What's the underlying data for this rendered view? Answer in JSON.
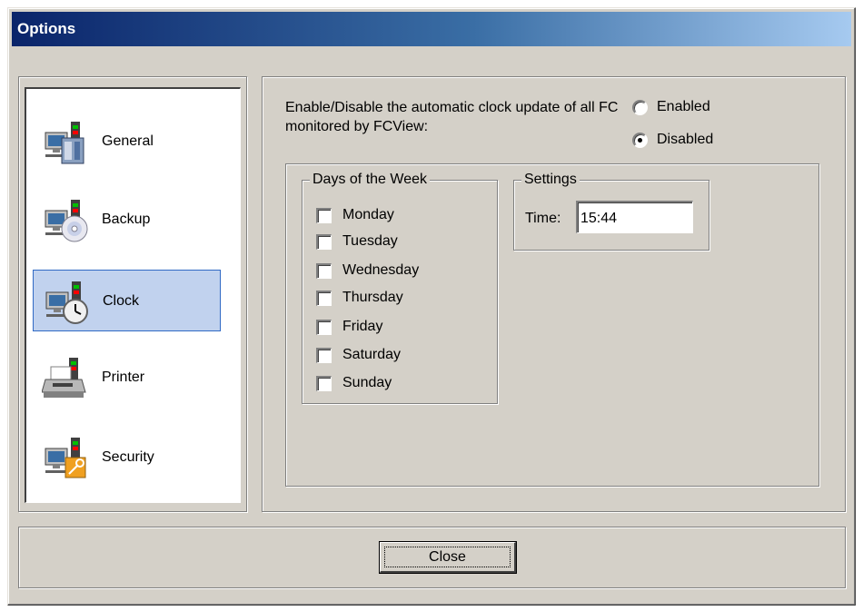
{
  "window": {
    "title": "Options"
  },
  "nav": {
    "items": [
      {
        "label": "General",
        "icon": "computer-tower-icon",
        "selected": false
      },
      {
        "label": "Backup",
        "icon": "computer-disc-icon",
        "selected": false
      },
      {
        "label": "Clock",
        "icon": "computer-clock-icon",
        "selected": true
      },
      {
        "label": "Printer",
        "icon": "printer-icon",
        "selected": false
      },
      {
        "label": "Security",
        "icon": "computer-key-icon",
        "selected": false
      }
    ]
  },
  "clock": {
    "description": "Enable/Disable the automatic clock update of all FC monitored by FCView:",
    "radio_enabled": "Enabled",
    "radio_disabled": "Disabled",
    "selected": "Disabled",
    "days_legend": "Days of the Week",
    "days": [
      "Monday",
      "Tuesday",
      "Wednesday",
      "Thursday",
      "Friday",
      "Saturday",
      "Sunday"
    ],
    "settings_legend": "Settings",
    "time_label": "Time:",
    "time_value": "15:44"
  },
  "footer": {
    "close_label": "Close"
  },
  "colors": {
    "title_gradient_start": "#0a246a",
    "title_gradient_end": "#a6caf0",
    "dialog_face": "#d4d0c8",
    "selection_fill": "#c1d2ee",
    "selection_border": "#316ac5"
  }
}
